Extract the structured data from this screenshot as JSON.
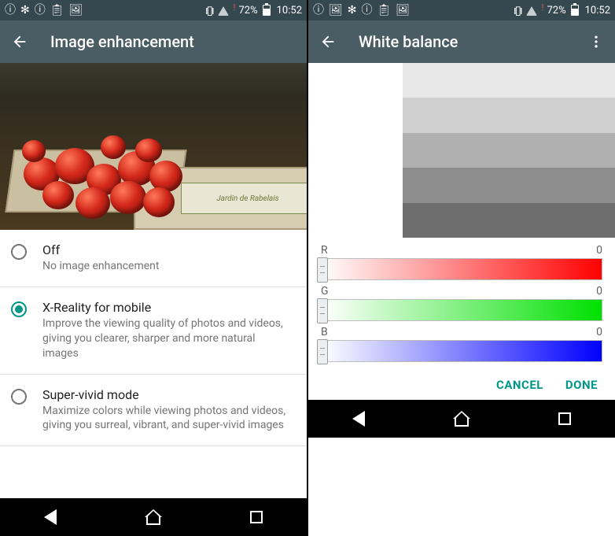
{
  "status": {
    "battery_pct": "72%",
    "time": "10:52"
  },
  "left": {
    "title": "Image enhancement",
    "crate_label": "Jardin de Rabelais",
    "options": [
      {
        "title": "Off",
        "desc": "No image enhancement",
        "checked": false
      },
      {
        "title": "X-Reality for mobile",
        "desc": "Improve the viewing quality of photos and videos, giving you clearer, sharper and more natural images",
        "checked": true
      },
      {
        "title": "Super-vivid mode",
        "desc": "Maximize colors while viewing photos and videos, giving you surreal, vibrant, and super-vivid images",
        "checked": false
      }
    ]
  },
  "right": {
    "title": "White balance",
    "swatches": [
      "#e8e8e8",
      "#cfcfcf",
      "#b0b0b0",
      "#8d8d8d",
      "#6e6e6e"
    ],
    "channels": [
      {
        "label": "R",
        "value": "0",
        "cls": "red"
      },
      {
        "label": "G",
        "value": "0",
        "cls": "green"
      },
      {
        "label": "B",
        "value": "0",
        "cls": "blue"
      }
    ],
    "actions": {
      "cancel": "CANCEL",
      "done": "DONE"
    }
  }
}
